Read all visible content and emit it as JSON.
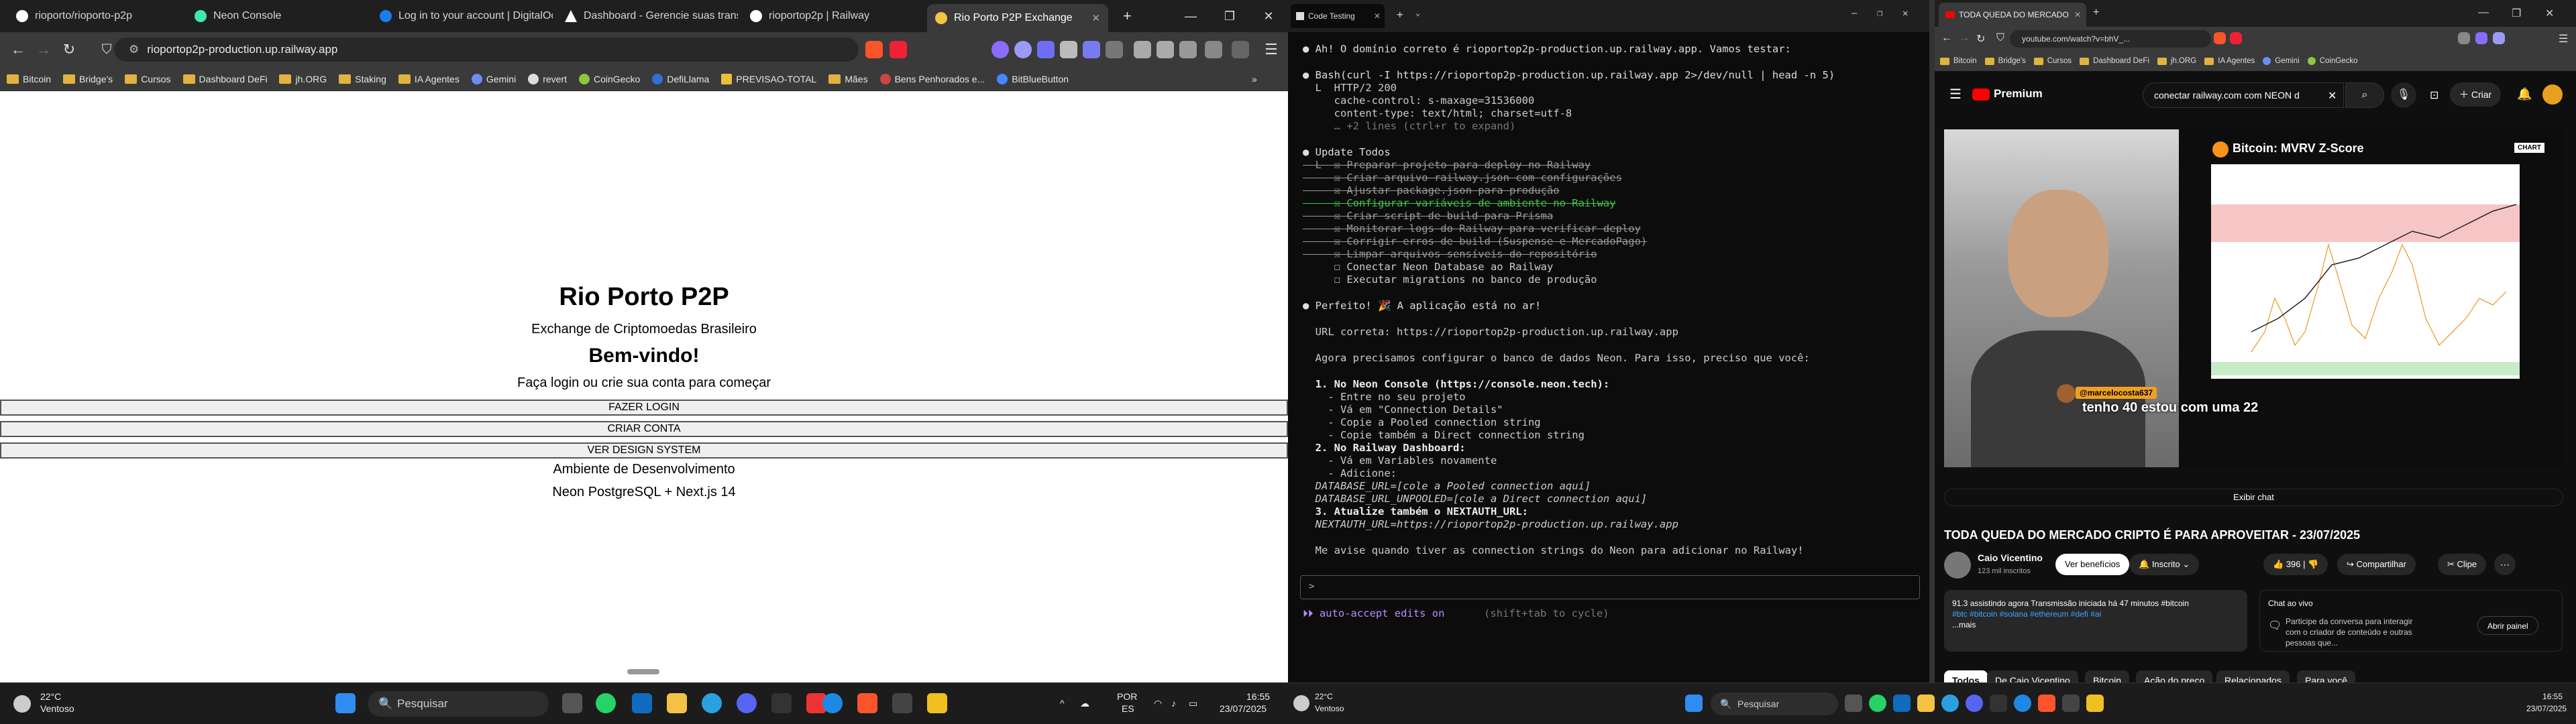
{
  "browser": {
    "tabs": [
      {
        "label": "rioporto/rioporto-p2p",
        "color": "#ffffff"
      },
      {
        "label": "Neon Console",
        "color": "#3ee8b5"
      },
      {
        "label": "Log in to your account | DigitalOcean",
        "color": "#1b7bf0"
      },
      {
        "label": "Dashboard - Gerencie suas transações",
        "color": "#ffffff"
      },
      {
        "label": "rioportop2p | Railway",
        "color": "#ffffff"
      },
      {
        "label": "Rio Porto P2P Exchange",
        "color": "#f5c542"
      }
    ],
    "url": "rioportop2p-production.up.railway.app",
    "bookmarks": [
      "Bitcoin",
      "Bridge's",
      "Cursos",
      "Dashboard DeFi",
      "jh.ORG",
      "Staking",
      "IA Agentes",
      "Gemini",
      "revert",
      "CoinGecko",
      "DefiLlama",
      "PREVISAO-TOTAL",
      "Mães",
      "Bens Penhorados e...",
      "BitBlueButton"
    ]
  },
  "page": {
    "title": "Rio Porto P2P",
    "subtitle": "Exchange de Criptomoedas Brasileiro",
    "welcome": "Bem-vindo!",
    "prompt": "Faça login ou crie sua conta para começar",
    "login_button": "FAZER LOGIN",
    "signup_button": "CRIAR CONTA",
    "design_button": "VER DESIGN SYSTEM",
    "env": "Ambiente de Desenvolvimento",
    "stack": "Neon PostgreSQL + Next.js 14"
  },
  "taskbar_left": {
    "weather_temp": "22°C",
    "weather_desc": "Ventoso",
    "search_placeholder": "Pesquisar",
    "lang1": "POR",
    "lang2": "ES",
    "time": "16:55",
    "date": "23/07/2025"
  },
  "terminal": {
    "tab_label": "Code Testing",
    "lines": [
      {
        "t": "● Ah! O domínio correto é rioportop2p-production.up.railway.app. Vamos testar:"
      },
      {
        "t": "● Bash(curl -I https://rioportop2p-production.up.railway.app 2>/dev/null | head -n 5)"
      },
      {
        "t": "  L  HTTP/2 200"
      },
      {
        "t": "     cache-control: s-maxage=31536000"
      },
      {
        "t": "     content-type: text/html; charset=utf-8"
      },
      {
        "t": "     … +2 lines (ctrl+r to expand)"
      },
      {
        "t": "● Update Todos"
      },
      {
        "t": "  L  ☒ Preparar projeto para deploy no Railway"
      },
      {
        "t": "     ☒ Criar arquivo railway.json com configurações"
      },
      {
        "t": "     ☒ Ajustar package.json para produção"
      },
      {
        "t": "     ☒ Configurar variáveis de ambiente no Railway"
      },
      {
        "t": "     ☒ Criar script de build para Prisma"
      },
      {
        "t": "     ☒ Monitorar logs do Railway para verificar deploy"
      },
      {
        "t": "     ☒ Corrigir erros de build (Suspense e MercadoPago)"
      },
      {
        "t": "     ☒ Limpar arquivos sensíveis do repositório"
      },
      {
        "t": "     ☐ Conectar Neon Database ao Railway"
      },
      {
        "t": "     ☐ Executar migrations no banco de produção"
      },
      {
        "t": "● Perfeito! 🎉 A aplicação está no ar!"
      },
      {
        "t": "  URL correta: https://rioportop2p-production.up.railway.app"
      },
      {
        "t": "  Agora precisamos configurar o banco de dados Neon. Para isso, preciso que você:"
      },
      {
        "t": "  1. No Neon Console (https://console.neon.tech):"
      },
      {
        "t": "    - Entre no seu projeto"
      },
      {
        "t": "    - Vá em \"Connection Details\""
      },
      {
        "t": "    - Copie a Pooled connection string"
      },
      {
        "t": "    - Copie também a Direct connection string"
      },
      {
        "t": "  2. No Railway Dashboard:"
      },
      {
        "t": "    - Vá em Variables novamente"
      },
      {
        "t": "    - Adicione:"
      },
      {
        "t": "  DATABASE_URL=[cole a Pooled connection aqui]"
      },
      {
        "t": "  DATABASE_URL_UNPOOLED=[cole a Direct connection aqui]"
      },
      {
        "t": "  3. Atualize também o NEXTAUTH_URL:"
      },
      {
        "t": "  NEXTAUTH_URL=https://rioportop2p-production.up.railway.app"
      },
      {
        "t": "  Me avise quando tiver as connection strings do Neon para adicionar no Railway!"
      }
    ],
    "input_prompt": ">",
    "footer_mode": "⏵⏵ auto-accept edits on",
    "footer_hint": "(shift+tab to cycle)"
  },
  "youtube": {
    "tab_label": "TODA QUEDA DO MERCADO",
    "url": "youtube.com/watch?v=bhV_...",
    "bookmarks": [
      "Bitcoin",
      "Bridge's",
      "Cursos",
      "Dashboard DeFi",
      "jh.ORG",
      "IA Agentes",
      "Gemini",
      "CoinGecko"
    ],
    "logo": "Premium",
    "search": "conectar railway.com com NEON d",
    "create": "Criar",
    "chart_title": "Bitcoin: MVRV Z-Score",
    "chart_badge": "CHART",
    "chat_user": "@marcelocosta637",
    "chat_msg": "tenho 40 estou com uma 22",
    "show_chat": "Exibir chat",
    "video_title": "TODA QUEDA DO MERCADO CRIPTO É PARA APROVEITAR - 23/07/2025",
    "channel": "Caio Vicentino",
    "subs": "123 mil inscritos",
    "benefits": "Ver benefícios",
    "subscribed": "Inscrito",
    "likes": "396",
    "share": "Compartilhar",
    "clip": "Clipe",
    "desc_line1": "91.3 assistindo agora  Transmissão iniciada há 47 minutos  #bitcoin",
    "desc_tags": "#btc #bitcoin #solana #ethereum #defi #ai",
    "desc_more": "...mais",
    "live_chat": "Chat ao vivo",
    "live_chat_desc": "Participe da conversa para interagir com o criador de conteúdo e outras pessoas que...",
    "open_panel": "Abrir painel",
    "chips": [
      "Todos",
      "De Caio Vicentino",
      "Bitcoin",
      "Ação do preço",
      "Relacionados",
      "Para você"
    ]
  },
  "taskbar_right": {
    "weather_temp": "22°C",
    "weather_desc": "Ventoso",
    "search_placeholder": "Pesquisar",
    "time": "16:55",
    "date": "23/07/2025"
  }
}
